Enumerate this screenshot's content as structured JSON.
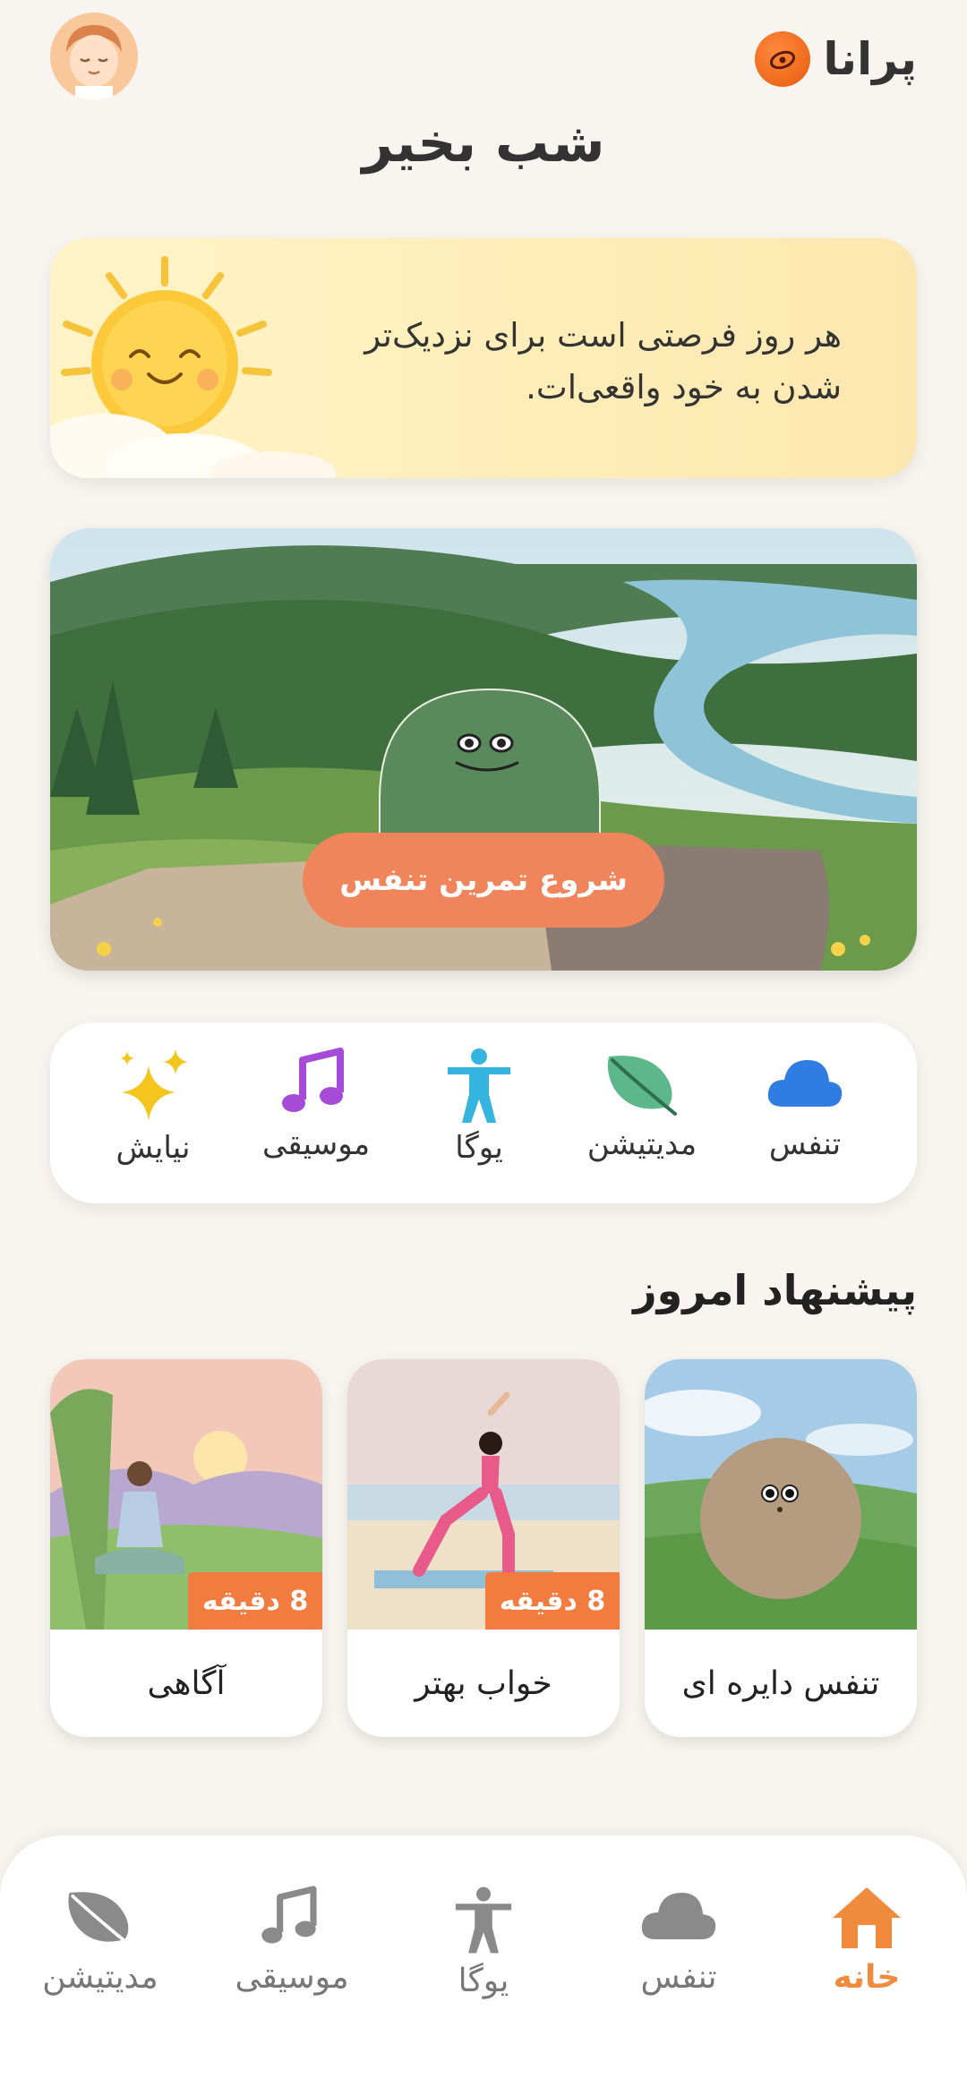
{
  "header": {
    "app_name": "پرانا",
    "greeting": "شب بخیر"
  },
  "quote": {
    "line1": "هر روز فرصتی است برای نزدیک‌تر",
    "line2": "شدن به خود واقعی‌ات."
  },
  "hero": {
    "cta_label": "شروع تمرین تنفس"
  },
  "categories": [
    {
      "label": "تنفس",
      "icon": "cloud-icon"
    },
    {
      "label": "مدیتیشن",
      "icon": "leaf-icon"
    },
    {
      "label": "یوگا",
      "icon": "person-icon"
    },
    {
      "label": "موسیقی",
      "icon": "music-note-icon"
    },
    {
      "label": "نیایش",
      "icon": "sparkles-icon"
    }
  ],
  "suggestions": {
    "title": "پیشنهاد امروز",
    "cards": [
      {
        "title": "تنفس دایره ای",
        "badge": ""
      },
      {
        "title": "خواب بهتر",
        "badge": "8 دقیقه"
      },
      {
        "title": "آگاهی",
        "badge": "8 دقیقه"
      }
    ]
  },
  "bottom_nav": [
    {
      "label": "خانه",
      "icon": "home-icon",
      "active": true
    },
    {
      "label": "تنفس",
      "icon": "cloud-icon",
      "active": false
    },
    {
      "label": "یوگا",
      "icon": "person-icon",
      "active": false
    },
    {
      "label": "موسیقی",
      "icon": "music-note-icon",
      "active": false
    },
    {
      "label": "مدیتیشن",
      "icon": "leaf-icon",
      "active": false
    }
  ],
  "colors": {
    "accent": "#f0845a",
    "badge": "#f27b3f",
    "nav_active": "#f08a3c",
    "background": "#f8f5f0"
  }
}
